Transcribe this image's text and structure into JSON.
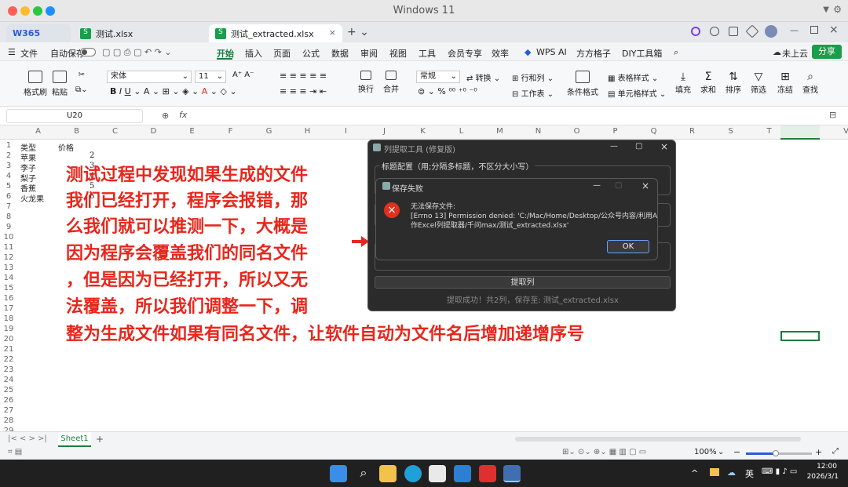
{
  "titlebar": {
    "title": "Windows 11"
  },
  "tabs": [
    {
      "label": "W365"
    },
    {
      "label": "测试.xlsx"
    },
    {
      "label": "测试_extracted.xlsx"
    }
  ],
  "menu": {
    "file": "文件",
    "autosave": "自动保存",
    "items": [
      "开始",
      "插入",
      "页面",
      "公式",
      "数据",
      "审阅",
      "视图",
      "工具",
      "会员专享",
      "效率",
      "WPS AI",
      "方方格子",
      "DIY工具箱"
    ],
    "cloud": "未上云",
    "share": "分享"
  },
  "ribbon": {
    "format_painter": "格式刷",
    "paste": "粘贴",
    "font": "宋体",
    "size": "11",
    "format": "常规",
    "convert": "转换",
    "rowcol": "行和列",
    "wrap": "换行",
    "merge": "合并",
    "worksheet": "工作表",
    "cond_format": "条件格式",
    "table_style": "表格样式",
    "cell_style": "单元格样式",
    "fill": "填充",
    "sum": "求和",
    "sort": "排序",
    "filter": "筛选",
    "freeze": "冻结",
    "find": "查找"
  },
  "formula": {
    "cellref": "U20",
    "fx": "fx"
  },
  "columns": [
    "A",
    "B",
    "C",
    "D",
    "E",
    "F",
    "G",
    "H",
    "I",
    "J",
    "K",
    "L",
    "M",
    "N",
    "O",
    "P",
    "Q",
    "R",
    "S",
    "T",
    "U",
    "V"
  ],
  "rows": [
    "1",
    "2",
    "3",
    "4",
    "5",
    "6",
    "7",
    "8",
    "9",
    "10",
    "11",
    "12",
    "13",
    "14",
    "15",
    "16",
    "17",
    "18",
    "19",
    "20",
    "21",
    "22",
    "23",
    "24",
    "25",
    "26",
    "27",
    "28",
    "29"
  ],
  "cells": {
    "a1": "类型",
    "b1": "价格",
    "a2": "苹果",
    "b2": "2",
    "a3": "李子",
    "b3": "3",
    "a4": "梨子",
    "b4": "4",
    "a5": "香蕉",
    "b5": "5",
    "a6": "火龙果",
    "b6": "6"
  },
  "annotation": [
    "测试过程中发现如果生成的文件",
    "我们已经打开，程序会报错，那",
    "么我们就可以推测一下，大概是",
    "因为程序会覆盖我们的同名文件",
    "，但是因为已经打开，所以又无",
    "法覆盖，所以我们调整一下，调",
    "整为生成文件如果有同名文件，让软件自动为文件名后增加递增序号"
  ],
  "tool": {
    "title": "列提取工具 (修复版)",
    "group": "标题配置（用;分隔多标题，不区分大小写）",
    "button": "提取列",
    "status": "提取成功！共2列，保存至: 测试_extracted.xlsx"
  },
  "dialog": {
    "title": "保存失败",
    "heading": "无法保存文件:",
    "message1": "[Errno 13] Permission denied: 'C:/Mac/Home/Desktop/公众号内容/利用AI制",
    "message2": "作Excel列提取器/千问max/测试_extracted.xlsx'",
    "ok": "OK"
  },
  "sheet": {
    "name": "Sheet1"
  },
  "status": {
    "zoom": "100%"
  },
  "taskbar": {
    "lang": "英",
    "time": "12:00",
    "date": "2026/3/1"
  },
  "colors": {
    "accent": "#1a7f3c",
    "annotation": "#e8261c",
    "error": "#e0301e"
  }
}
